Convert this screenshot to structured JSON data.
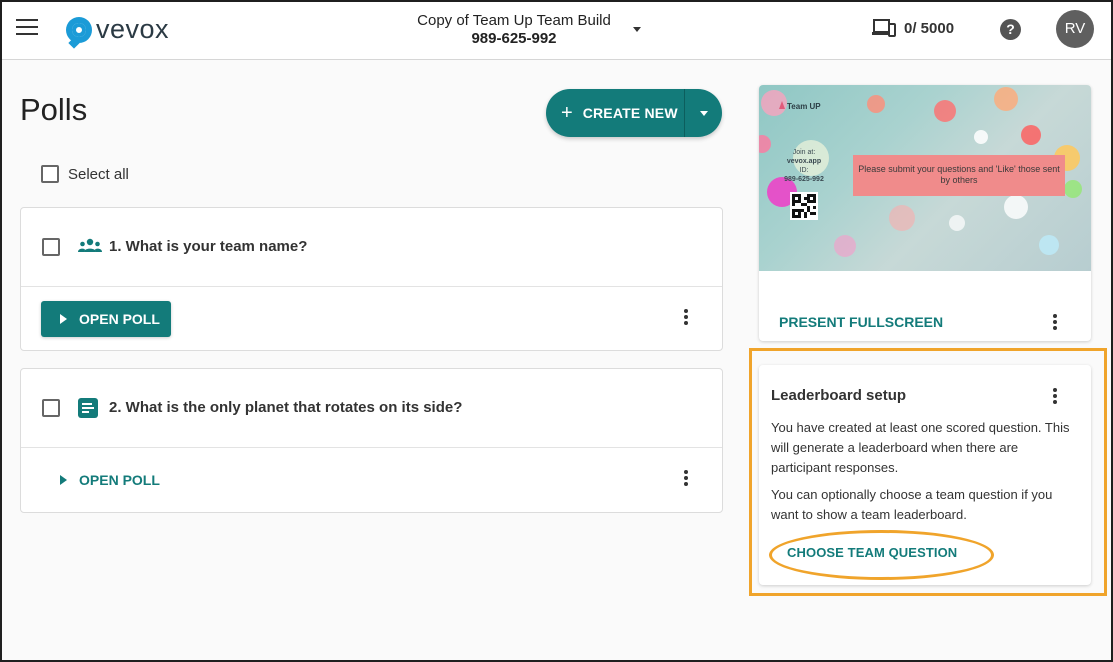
{
  "app": {
    "logo_text": "vevox",
    "brand_color": "#1b9bd7",
    "accent_color": "#137b7a",
    "highlight_color": "#f0a42b"
  },
  "header": {
    "menu_icon": "hamburger-menu-icon",
    "event_title": "Copy of Team Up Team Build",
    "event_code": "989-625-992",
    "devices_icon": "devices-icon",
    "participants": "0/ 5000",
    "help_label": "?",
    "avatar_initials": "RV"
  },
  "main": {
    "title": "Polls",
    "create_new_label": "CREATE NEW",
    "select_all_label": "Select all",
    "polls": [
      {
        "question": "1. What is your team name?",
        "icon": "team-icon",
        "open_label": "OPEN POLL",
        "open_style": "filled"
      },
      {
        "question": "2. What is the only planet that rotates on its side?",
        "icon": "text-poll-icon",
        "open_label": "OPEN POLL",
        "open_style": "text"
      }
    ]
  },
  "preview": {
    "slide_team": "Team UP",
    "slide_join_label": "Join at:",
    "slide_join_url": "vevox.app",
    "slide_id_label": "ID:",
    "slide_id": "989-625-992",
    "slide_message": "Please submit your questions and 'Like' those sent by others",
    "present_label": "PRESENT FULLSCREEN"
  },
  "leaderboard": {
    "title": "Leaderboard setup",
    "paragraph_1": "You have created at least one scored question. This will generate a leaderboard when there are participant responses.",
    "paragraph_2": "You can optionally choose a team question if you want to show a team leaderboard.",
    "choose_label": "CHOOSE TEAM QUESTION"
  }
}
